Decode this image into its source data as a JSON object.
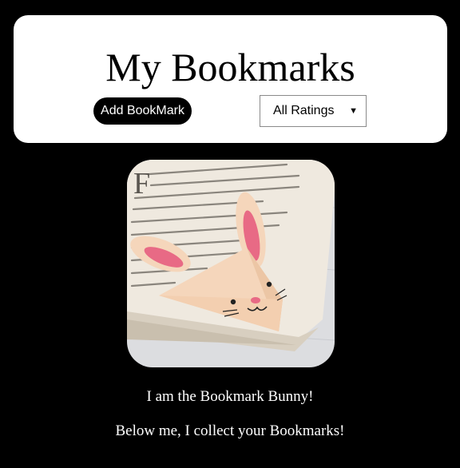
{
  "header": {
    "title": "My Bookmarks",
    "add_button_label": "Add BookMark",
    "rating_filter": {
      "selected": "All Ratings",
      "arrow_icon": "triangle-down-icon"
    }
  },
  "hero": {
    "image_subject": "origami-bunny-bookmark-on-book",
    "caption_line_1": "I am the Bookmark Bunny!",
    "caption_line_2": "Below me, I collect your Bookmarks!"
  },
  "colors": {
    "page_background": "#000000",
    "card_background": "#ffffff",
    "button_background": "#000000",
    "bunny_paper": "#f5d6bb",
    "bunny_ear_inner": "#e86a85"
  }
}
